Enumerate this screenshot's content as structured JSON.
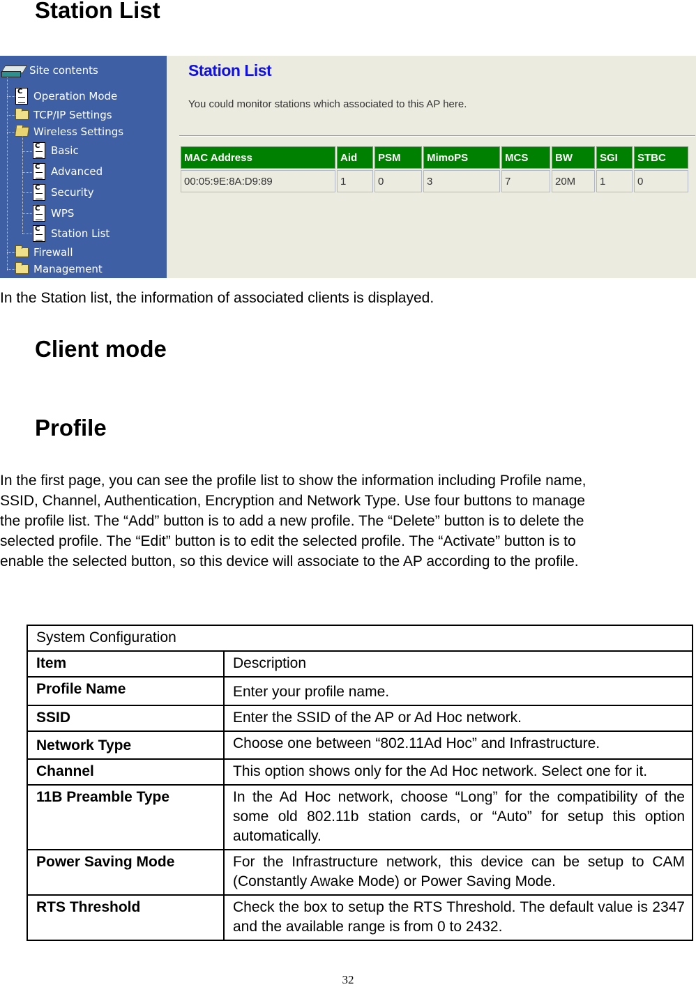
{
  "sections": {
    "station_list_heading": "Station List",
    "station_list_caption": "In the Station list, the information of associated clients is displayed.",
    "client_mode_heading": "Client mode",
    "profile_heading": "Profile",
    "profile_paragraph": [
      "In the first page, you can see the profile list to show the information including Profile name,",
      "SSID, Channel, Authentication, Encryption and Network Type. Use four buttons to manage",
      "the profile list. The “Add” button is to add a new profile. The “Delete” button is to delete the",
      "selected profile. The “Edit” button is to edit the selected profile. The “Activate” button is to",
      "enable the selected button, so this device will associate to the AP according to the profile."
    ]
  },
  "screenshot": {
    "sidebar": {
      "root": {
        "label": "Site contents",
        "icon": "drive-icon"
      },
      "items": [
        {
          "label": "Operation Mode",
          "icon": "document-icon",
          "level": 1
        },
        {
          "label": "TCP/IP Settings",
          "icon": "folder-icon",
          "level": 1
        },
        {
          "label": "Wireless Settings",
          "icon": "folder-open-icon",
          "level": 1
        },
        {
          "label": "Basic",
          "icon": "document-icon",
          "level": 2
        },
        {
          "label": "Advanced",
          "icon": "document-icon",
          "level": 2
        },
        {
          "label": "Security",
          "icon": "document-icon",
          "level": 2
        },
        {
          "label": "WPS",
          "icon": "document-icon",
          "level": 2
        },
        {
          "label": "Station List",
          "icon": "document-icon",
          "level": 2
        },
        {
          "label": "Firewall",
          "icon": "folder-icon",
          "level": 1
        },
        {
          "label": "Management",
          "icon": "folder-icon",
          "level": 1
        }
      ],
      "background_color": "#3f5fa5"
    },
    "content": {
      "title": "Station List",
      "description": "You could monitor stations which associated to this AP here.",
      "title_color": "#1010e0",
      "header_color": "#008000",
      "table": {
        "columns": [
          "MAC Address",
          "Aid",
          "PSM",
          "MimoPS",
          "MCS",
          "BW",
          "SGI",
          "STBC"
        ],
        "rows": [
          [
            "00:05:9E:8A:D9:89",
            "1",
            "0",
            "3",
            "7",
            "20M",
            "1",
            "0"
          ]
        ]
      }
    }
  },
  "system_config_table": {
    "title": "System Configuration",
    "header": {
      "item": "Item",
      "description": "Description"
    },
    "rows": [
      {
        "item": "Profile Name",
        "description": "Enter your profile name."
      },
      {
        "item": "SSID",
        "description": "Enter the SSID of the AP or Ad Hoc network."
      },
      {
        "item": "Network Type",
        "description": "Choose one between “802.11Ad Hoc” and Infrastructure."
      },
      {
        "item": "Channel",
        "description": "This option shows only for the Ad Hoc network. Select one for it."
      },
      {
        "item": "11B Preamble Type",
        "description": "In the Ad Hoc network, choose “Long” for the compatibility of the some old 802.11b station cards, or “Auto” for setup this option automatically."
      },
      {
        "item": "Power Saving Mode",
        "description": "For the Infrastructure network, this device can be setup to CAM (Constantly Awake Mode) or Power Saving Mode."
      },
      {
        "item": "RTS Threshold",
        "description": "Check the box to setup the RTS Threshold. The default value is 2347 and the available range is from 0 to 2432."
      }
    ]
  },
  "page_number": "32"
}
